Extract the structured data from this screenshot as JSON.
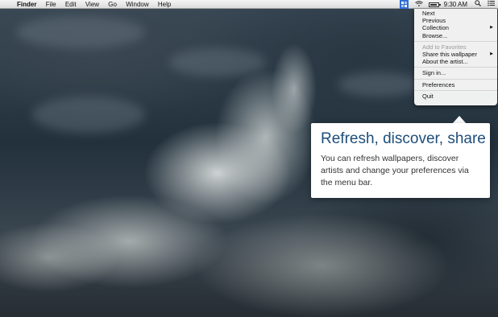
{
  "menubar": {
    "apple": "",
    "menus": [
      "Finder",
      "File",
      "Edit",
      "View",
      "Go",
      "Window",
      "Help"
    ],
    "clock": "9:30 AM",
    "icons": [
      "wallpaper-app-icon",
      "wifi-icon",
      "battery-icon",
      "search-icon",
      "list-icon"
    ]
  },
  "dropdown": {
    "items": [
      {
        "label": "Next"
      },
      {
        "label": "Previous"
      },
      {
        "label": "Collection",
        "submenu": "▶"
      },
      {
        "label": "Browse..."
      },
      {
        "label": "Add to Favorites",
        "disabled": true
      },
      {
        "label": "Share this wallpaper",
        "submenu": "▶"
      },
      {
        "label": "About the artist..."
      },
      {
        "label": "Sign in..."
      },
      {
        "label": "Preferences"
      },
      {
        "label": "Quit"
      }
    ]
  },
  "callout": {
    "title": "Refresh, discover, share",
    "body": "You can refresh wallpapers, discover artists and change your preferences via the menu bar."
  },
  "colors": {
    "accent": "#2f6fd6",
    "callout_title": "#1d4e7a"
  }
}
